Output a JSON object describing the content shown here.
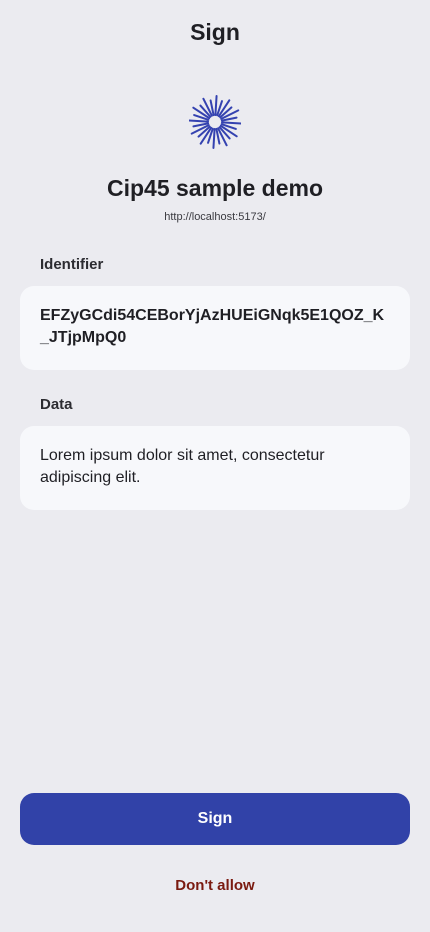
{
  "header": {
    "title": "Sign"
  },
  "app": {
    "logo_icon": "sunburst-logo-icon",
    "name": "Cip45 sample demo",
    "url": "http://localhost:5173/"
  },
  "identifier": {
    "label": "Identifier",
    "value": "EFZyGCdi54CEBorYjAzHUEiGNqk5E1QOZ_K_JTjpMpQ0"
  },
  "data_field": {
    "label": "Data",
    "value": "Lorem ipsum dolor sit amet, consectetur adipiscing elit."
  },
  "actions": {
    "sign_label": "Sign",
    "deny_label": "Don't allow"
  },
  "colors": {
    "background": "#ebebf0",
    "card": "#f7f8fb",
    "primary": "#3142a8",
    "deny": "#7a1a10",
    "logo": "#3442b0"
  }
}
